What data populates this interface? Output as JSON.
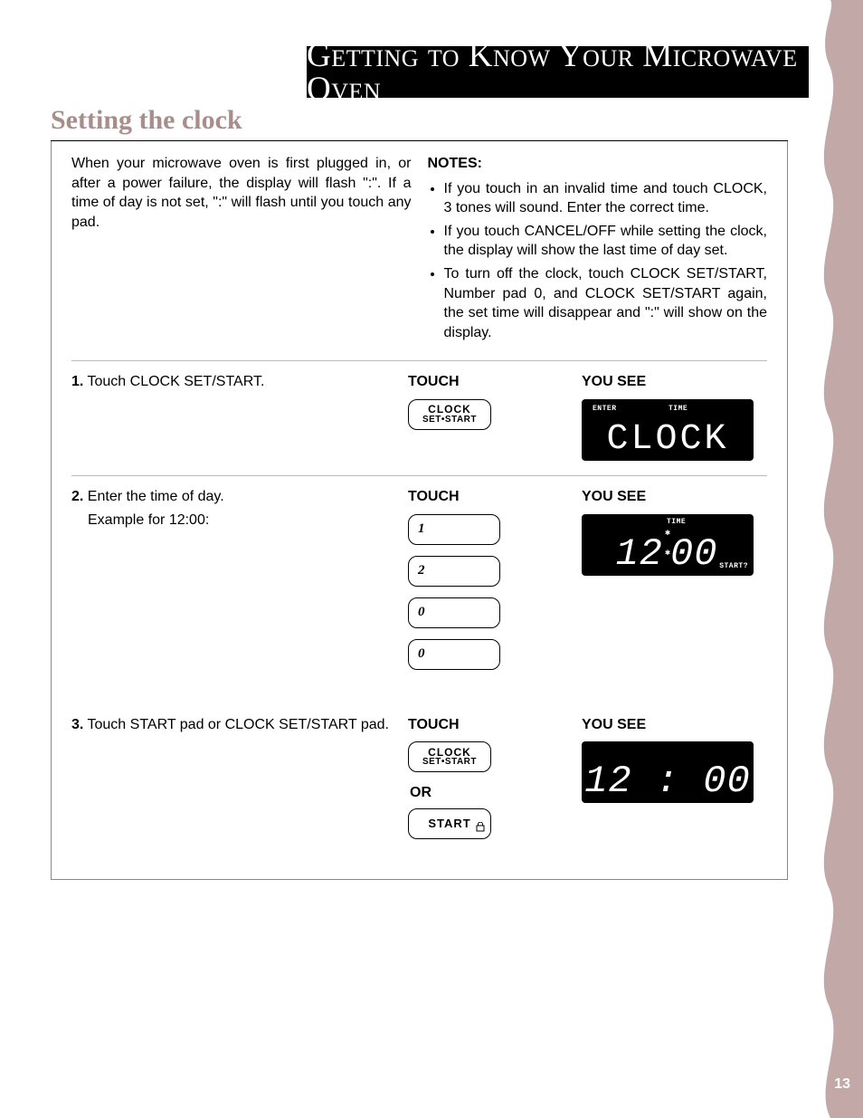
{
  "page_number": "13",
  "titlebar": "Getting to Know Your Microwave Oven",
  "section_title": "Setting the clock",
  "intro": {
    "left": "When your microwave oven is first plugged in, or after a power failure, the display will flash \":\". If a time of day is not set, \":\" will flash until you touch any pad.",
    "notes_label": "NOTES:",
    "notes": [
      "If you touch in an invalid time and touch CLOCK, 3 tones will sound. Enter the correct time.",
      "If you touch CANCEL/OFF while setting the clock, the display will show the last time of day set.",
      "To turn off the clock, touch CLOCK SET/START, Number pad 0, and CLOCK SET/START again, the set time will disappear and \":\" will show on the display."
    ]
  },
  "labels": {
    "touch": "TOUCH",
    "yousee": "YOU SEE",
    "or": "OR"
  },
  "pads": {
    "clock_line1": "CLOCK",
    "clock_line2": "SET•START",
    "start": "START",
    "num1": "1",
    "num2": "2",
    "num0a": "0",
    "num0b": "0"
  },
  "steps": {
    "s1": {
      "num": "1.",
      "text": "Touch CLOCK SET/START."
    },
    "s2": {
      "num": "2.",
      "text": "Enter the time of day.",
      "example": "Example for 12:00:"
    },
    "s3": {
      "num": "3.",
      "text": "Touch START pad or CLOCK SET/START pad."
    }
  },
  "screens": {
    "s1": {
      "enter": "ENTER",
      "time": "TIME",
      "seg": "CLOCK"
    },
    "s2": {
      "time": "TIME",
      "hhmm_left": "12",
      "hhmm_right": "00",
      "startq": "START?"
    },
    "s3": {
      "hhmm": "12 : 00"
    }
  }
}
